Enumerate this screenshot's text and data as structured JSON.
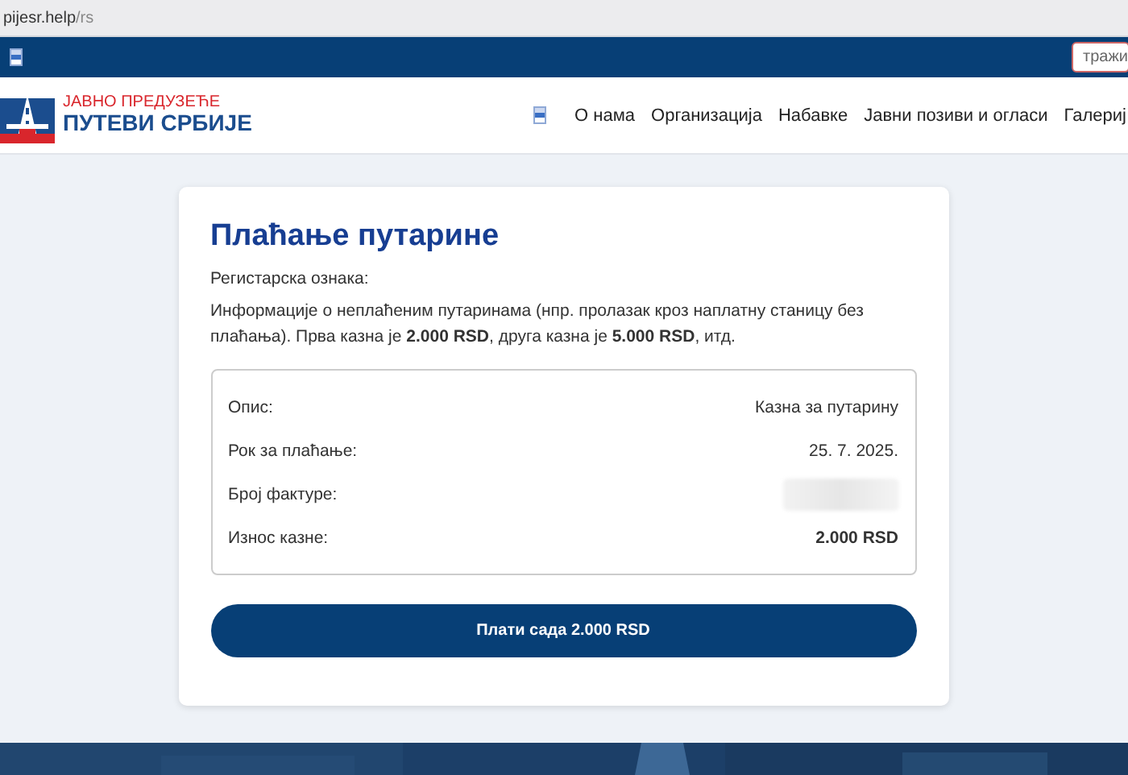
{
  "browser": {
    "url_host": "pijesr.help",
    "url_path": "/rs"
  },
  "topbar": {
    "search": {
      "placeholder": "тражи"
    }
  },
  "header": {
    "logo": {
      "line_1": "ЈАВНО ПРЕДУЗЕЋЕ",
      "line_2": "ПУТЕВИ СРБИЈЕ"
    },
    "nav": [
      {
        "label": "О нама"
      },
      {
        "label": "Организација"
      },
      {
        "label": "Набавке"
      },
      {
        "label": "Јавни позиви и огласи"
      },
      {
        "label": "Галериј"
      }
    ]
  },
  "card": {
    "title": "Плаћање путарине",
    "label": "Регистарска ознака:",
    "info": "Информације о неплаћеним путаринама (нпр. пролазак кроз наплатну станицу без плаћања). Прва казна је **2.000 RSD**, друга казна је **5.000 RSD**, итд.",
    "details": [
      {
        "label": "Опис:",
        "value": "Казна за путарину",
        "kind": "text"
      },
      {
        "label": "Рок за плаћање:",
        "value": "25. 7. 2025.",
        "kind": "text"
      },
      {
        "label": "Број фактуре:",
        "kind": "hidden"
      },
      {
        "label": "Износ казне:",
        "value": "2.000 RSD",
        "kind": "bold"
      }
    ],
    "button": "Плати сада 2.000 RSD"
  }
}
